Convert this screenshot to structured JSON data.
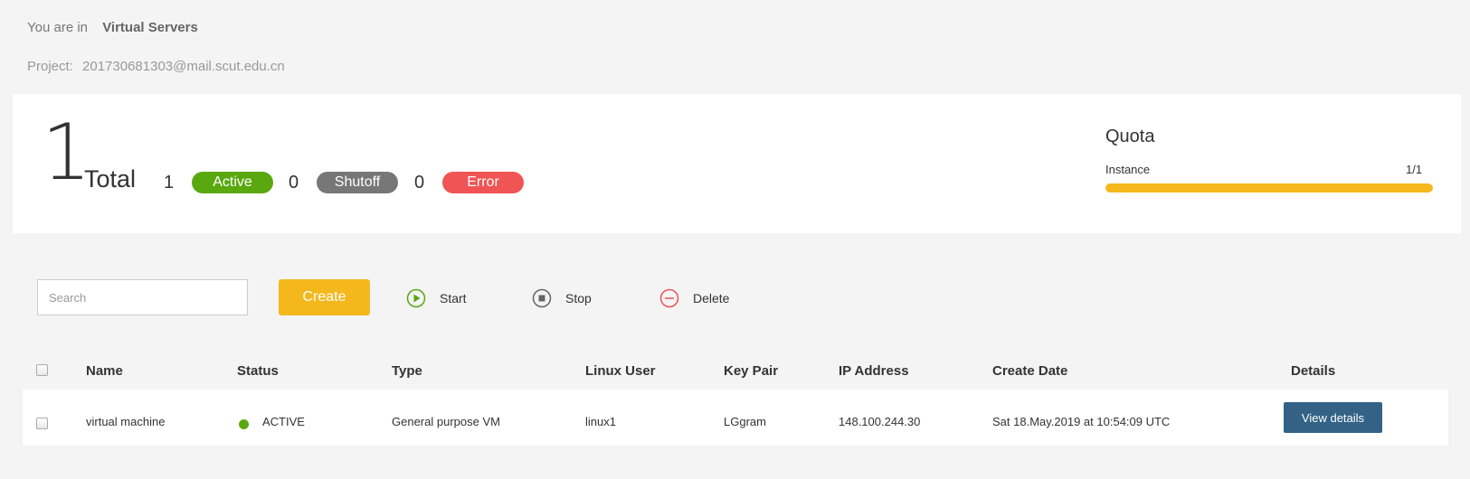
{
  "breadcrumb": {
    "prefix": "You are in",
    "current": "Virtual Servers"
  },
  "project": {
    "label": "Project:",
    "value": "201730681303@mail.scut.edu.cn"
  },
  "summary": {
    "total": "1",
    "total_label": "Total",
    "active": {
      "count": "1",
      "label": "Active",
      "color": "#5aa80f"
    },
    "shutoff": {
      "count": "0",
      "label": "Shutoff",
      "color": "#777777"
    },
    "error": {
      "count": "0",
      "label": "Error",
      "color": "#f05454"
    }
  },
  "quota": {
    "title": "Quota",
    "instance_label": "Instance",
    "instance_value": "1/1",
    "fill_fraction": 1.0,
    "bar_color": "#f5b81c"
  },
  "toolbar": {
    "search_placeholder": "Search",
    "create_label": "Create",
    "start_label": "Start",
    "stop_label": "Stop",
    "delete_label": "Delete"
  },
  "table": {
    "headers": [
      "Name",
      "Status",
      "Type",
      "Linux User",
      "Key Pair",
      "IP Address",
      "Create Date",
      "Details"
    ],
    "rows": [
      {
        "name": "virtual machine",
        "status": "ACTIVE",
        "type": "General purpose VM",
        "linux_user": "linux1",
        "key_pair": "LGgram",
        "ip": "148.100.244.30",
        "create_date": "Sat 18.May.2019 at 10:54:09 UTC",
        "details_label": "View details"
      }
    ]
  }
}
